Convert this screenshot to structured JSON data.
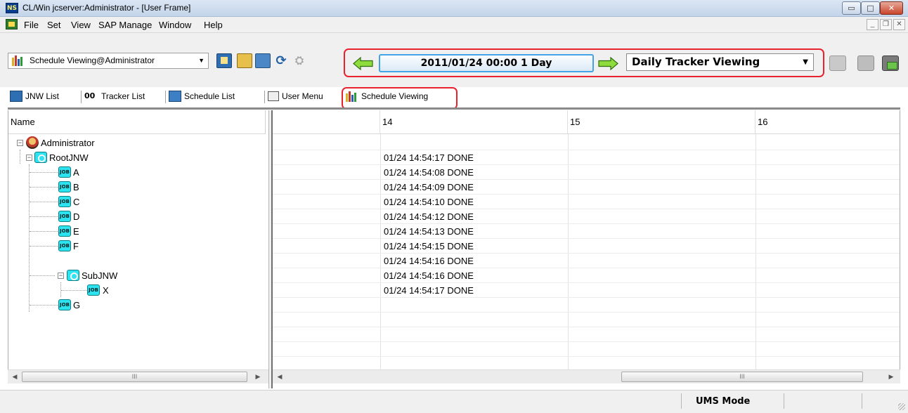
{
  "window": {
    "title": "CL/Win jcserver:Administrator - [User Frame]",
    "app_icon_text": "NS",
    "controls": {
      "minimize": "▭",
      "maximize": "□",
      "close": "✕"
    }
  },
  "menu": {
    "items": [
      "File",
      "Set",
      "View",
      "SAP Manage",
      "Window",
      "Help"
    ],
    "mdi_controls": {
      "minimize": "_",
      "restore": "❐",
      "close": "✕"
    }
  },
  "toolbar": {
    "view_select": "Schedule Viewing@Administrator",
    "date_label": "2011/01/24 00:00  1 Day",
    "mode_select": "Daily Tracker Viewing"
  },
  "tabs": [
    {
      "label": "JNW List",
      "icon": "jnw-list-icon"
    },
    {
      "label": "Tracker List",
      "icon": "tracker-list-icon"
    },
    {
      "label": "Schedule List",
      "icon": "schedule-list-icon"
    },
    {
      "label": "User Menu",
      "icon": "user-menu-icon"
    },
    {
      "label": "Schedule Viewing",
      "icon": "schedule-viewing-icon",
      "active": true
    }
  ],
  "tree": {
    "header": "Name",
    "nodes": [
      {
        "label": "Administrator",
        "type": "user",
        "status": ""
      },
      {
        "label": "RootJNW",
        "type": "jnw",
        "status": "01/24 14:54:17 DONE"
      },
      {
        "label": "A",
        "type": "job",
        "status": "01/24 14:54:08 DONE"
      },
      {
        "label": "B",
        "type": "job",
        "status": "01/24 14:54:09 DONE"
      },
      {
        "label": "C",
        "type": "job",
        "status": "01/24 14:54:10 DONE"
      },
      {
        "label": "D",
        "type": "job",
        "status": "01/24 14:54:12 DONE"
      },
      {
        "label": "E",
        "type": "job",
        "status": "01/24 14:54:13 DONE"
      },
      {
        "label": "F",
        "type": "job",
        "status": "01/24 14:54:15 DONE"
      },
      {
        "label": "SubJNW",
        "type": "jnw",
        "status": "01/24 14:54:16 DONE"
      },
      {
        "label": "X",
        "type": "job",
        "status": "01/24 14:54:16 DONE"
      },
      {
        "label": "G",
        "type": "job",
        "status": "01/24 14:54:17 DONE"
      }
    ],
    "job_icon_text": "JOB",
    "expander_glyph": "−"
  },
  "timeline": {
    "hours": [
      "14",
      "15",
      "16"
    ]
  },
  "scrollbars": {
    "left": "◀",
    "right": "▶",
    "grip": "III"
  },
  "status": {
    "mode": "UMS Mode"
  },
  "colors": {
    "highlight": "#e8232f",
    "date_border": "#42a4e6",
    "job_icon": "#2ee3f0"
  }
}
